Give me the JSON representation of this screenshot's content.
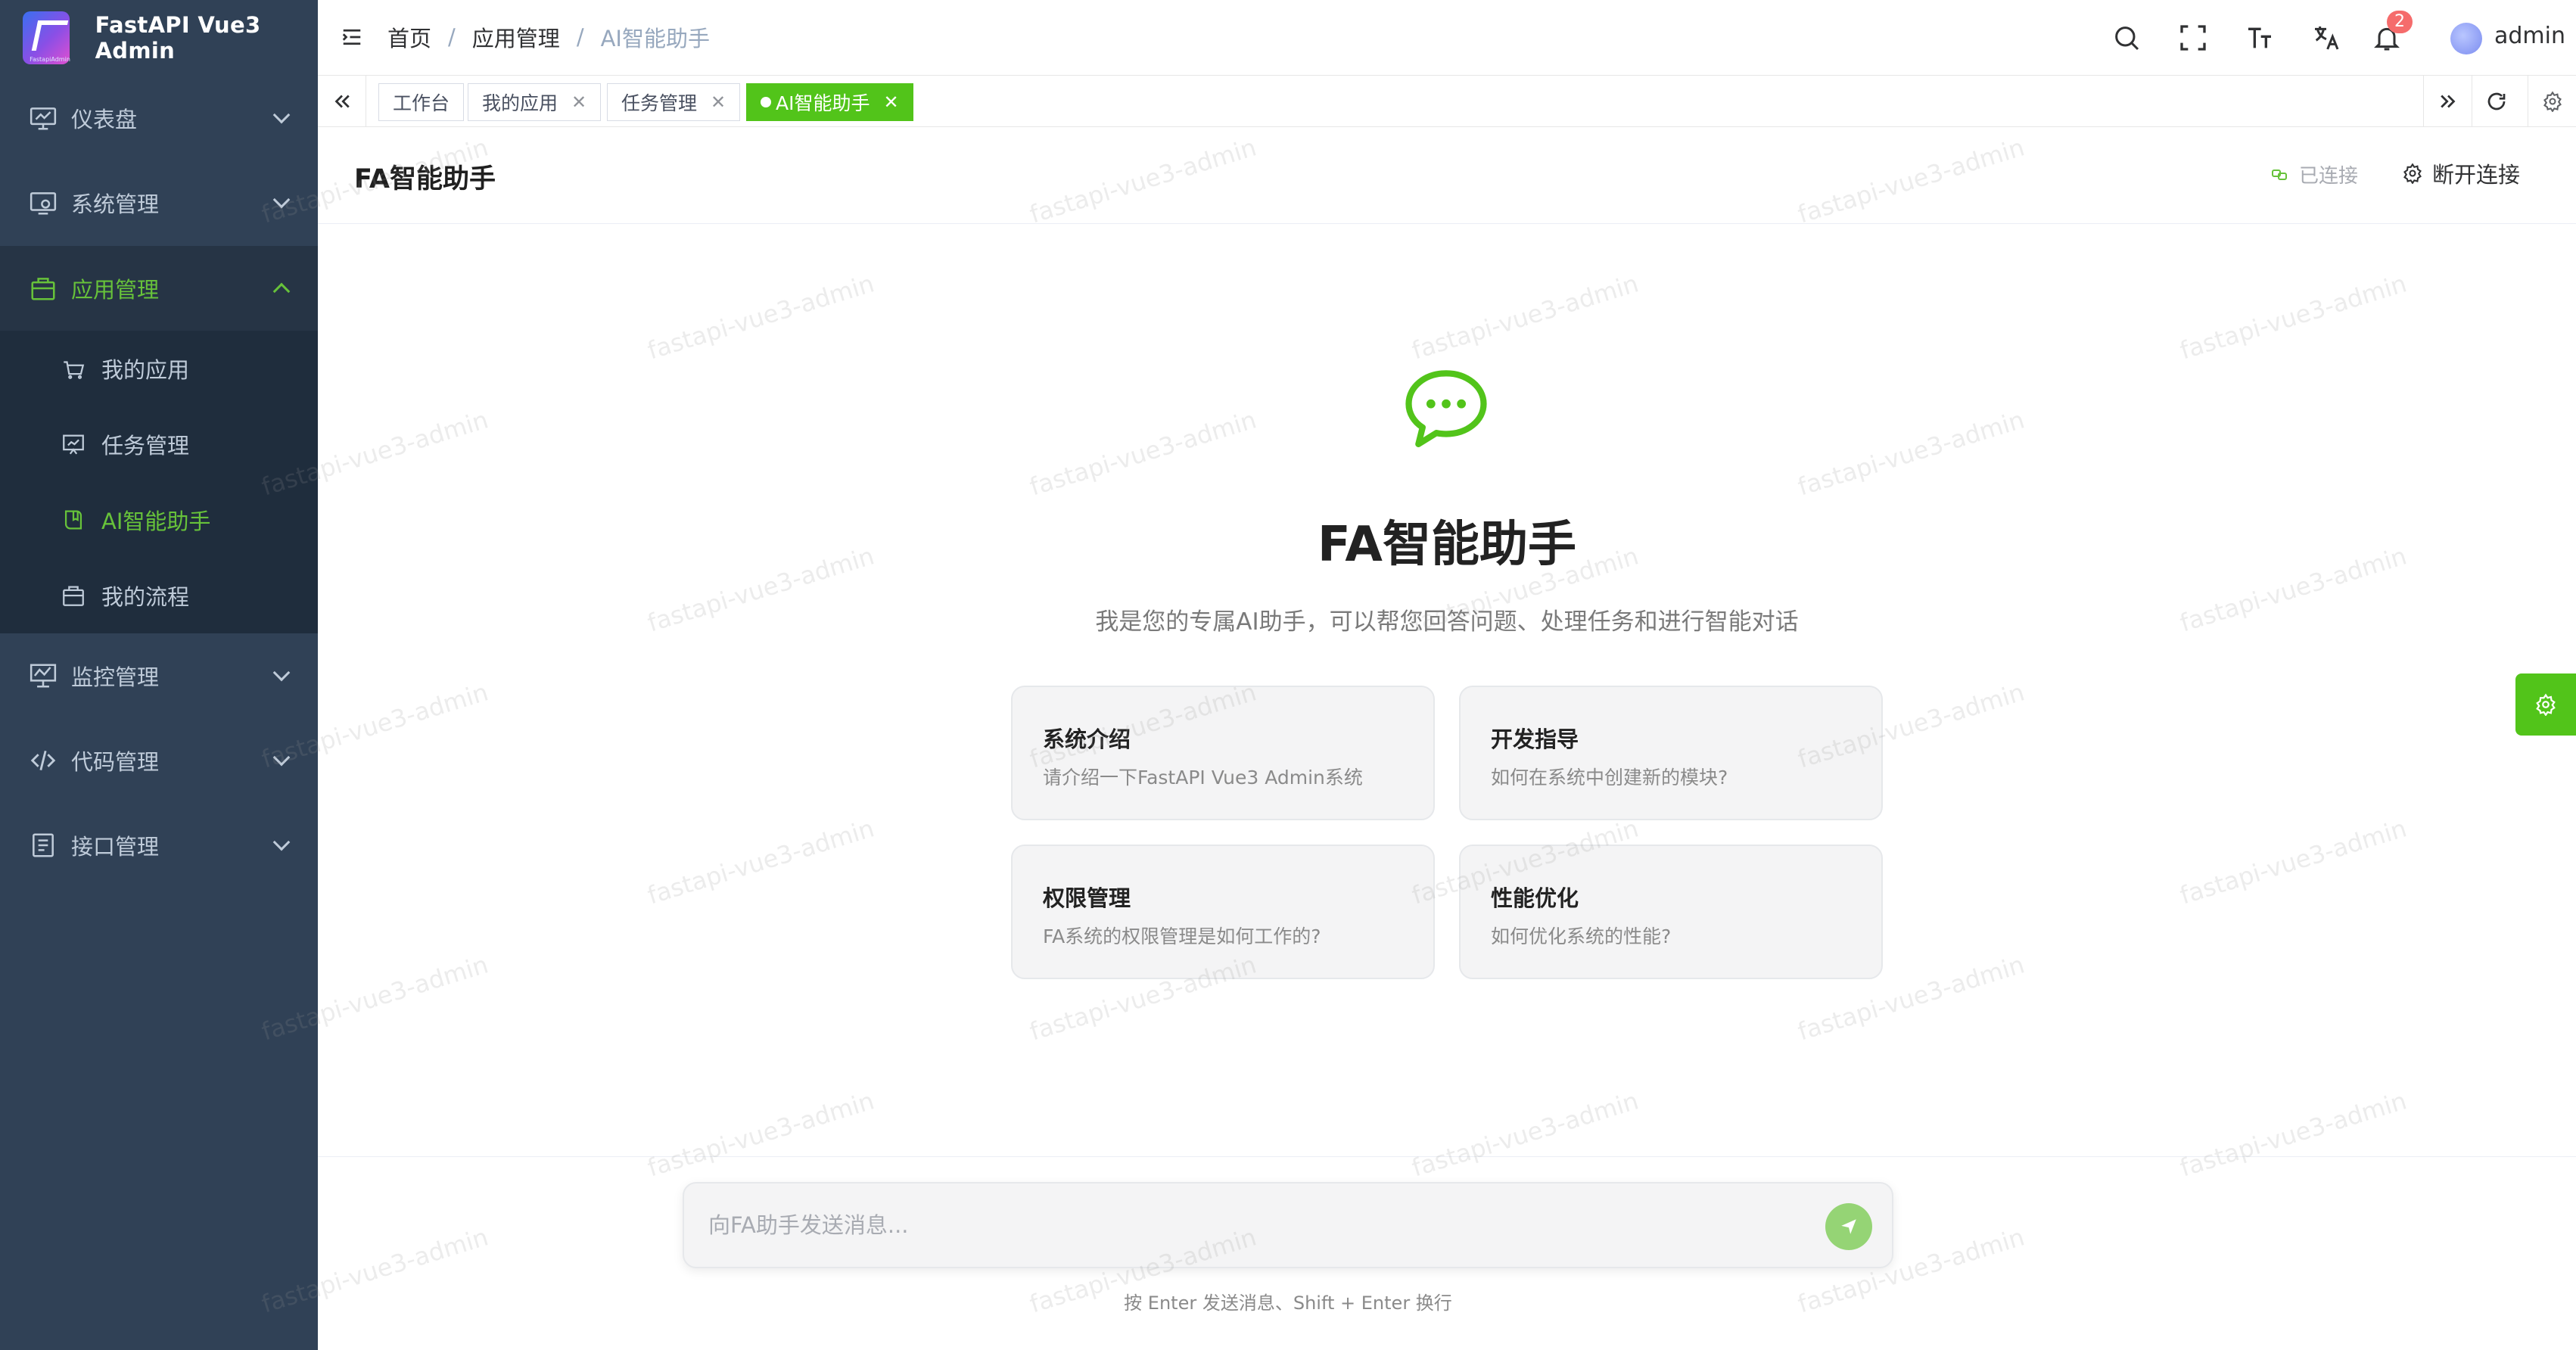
{
  "app": {
    "logo_caption": "FastapiAdmin",
    "title": "FastAPI Vue3 Admin"
  },
  "sidebar": {
    "items": [
      {
        "label": "仪表盘",
        "icon": "monitor-icon"
      },
      {
        "label": "系统管理",
        "icon": "system-icon"
      },
      {
        "label": "应用管理",
        "icon": "bag-icon",
        "expanded": true
      },
      {
        "label": "监控管理",
        "icon": "chart-monitor-icon"
      },
      {
        "label": "代码管理",
        "icon": "code-icon"
      },
      {
        "label": "接口管理",
        "icon": "document-icon"
      }
    ],
    "subitems": [
      {
        "label": "我的应用",
        "icon": "basket-icon"
      },
      {
        "label": "任务管理",
        "icon": "board-icon"
      },
      {
        "label": "AI智能助手",
        "icon": "ai-book-icon",
        "current": true
      },
      {
        "label": "我的流程",
        "icon": "briefcase-icon"
      }
    ]
  },
  "header": {
    "breadcrumb": [
      "首页",
      "应用管理",
      "AI智能助手"
    ],
    "notification_count": "2",
    "username": "admin",
    "icons": [
      "search-icon",
      "fullscreen-icon",
      "font-size-icon",
      "translate-icon",
      "bell-icon"
    ]
  },
  "tags": [
    {
      "label": "工作台",
      "closable": false
    },
    {
      "label": "我的应用",
      "closable": true
    },
    {
      "label": "任务管理",
      "closable": true
    },
    {
      "label": "AI智能助手",
      "closable": true,
      "active": true
    }
  ],
  "page": {
    "title": "FA智能助手",
    "connection_status": "已连接",
    "disconnect_label": "断开连接"
  },
  "welcome": {
    "title": "FA智能助手",
    "subtitle": "我是您的专属AI助手，可以帮您回答问题、处理任务和进行智能对话",
    "cards": [
      {
        "title": "系统介绍",
        "desc": "请介绍一下FastAPI Vue3 Admin系统"
      },
      {
        "title": "开发指导",
        "desc": "如何在系统中创建新的模块?"
      },
      {
        "title": "权限管理",
        "desc": "FA系统的权限管理是如何工作的?"
      },
      {
        "title": "性能优化",
        "desc": "如何优化系统的性能?"
      }
    ]
  },
  "input": {
    "placeholder": "向FA助手发送消息...",
    "value": "",
    "hint": "按 Enter 发送消息、Shift + Enter 换行"
  },
  "watermark": "fastapi-vue3-admin",
  "colors": {
    "sidebar_bg": "#304156",
    "sidebar_active_bg": "#263445",
    "submenu_bg": "#1f2d3d",
    "accent": "#52c41a",
    "active_text": "#67c23a",
    "badge": "#f56c6c"
  }
}
